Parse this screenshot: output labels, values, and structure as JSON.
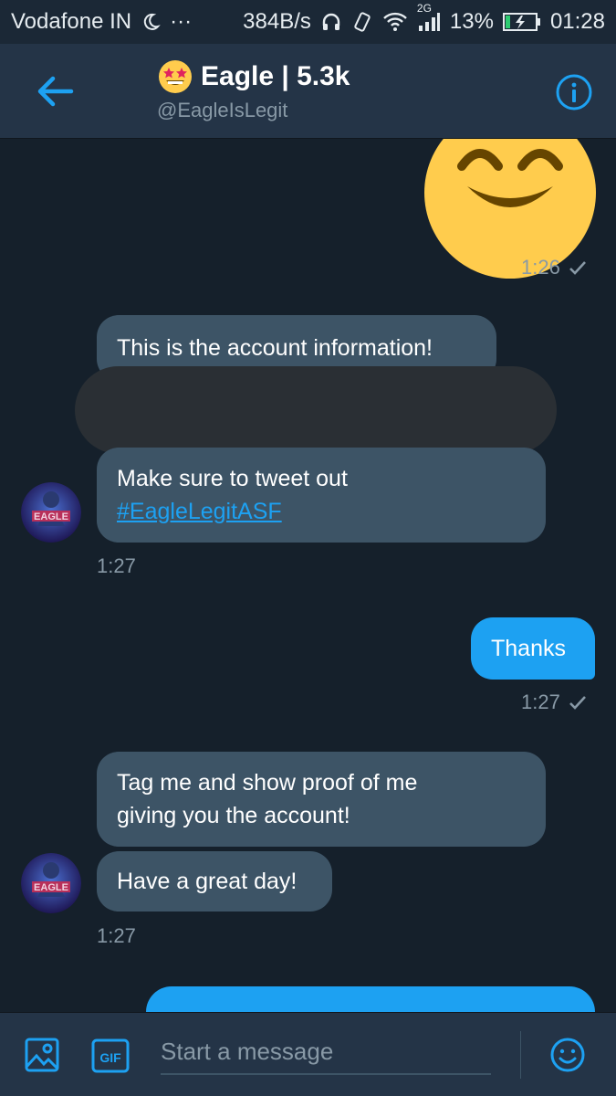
{
  "status_bar": {
    "carrier": "Vodafone IN",
    "dots": "···",
    "speed": "384B/s",
    "network": "2G",
    "battery": "13%",
    "time": "01:28"
  },
  "header": {
    "title": "Eagle | 5.3k",
    "handle": "@EagleIsLegit",
    "back_icon": "arrow-left-icon",
    "info_icon": "info-icon",
    "title_emoji": "star-struck-emoji"
  },
  "messages": [
    {
      "from": "me",
      "type": "emoji",
      "emoji": "smiling-face-emoji",
      "time": "1:26"
    },
    {
      "from": "them",
      "text": "This is the account information!"
    },
    {
      "from": "them",
      "text": "",
      "redacted": true
    },
    {
      "from": "them",
      "text": "Make sure to tweet out",
      "link": "#EagleLegitASF",
      "time": "1:27"
    },
    {
      "from": "me",
      "text": "Thanks",
      "time": "1:27"
    },
    {
      "from": "them",
      "lines": [
        "Tag me and show proof of me",
        "giving you the account!"
      ]
    },
    {
      "from": "them",
      "text": "Have a great day!",
      "time": "1:27"
    }
  ],
  "avatar_label": "EAGLE",
  "composer": {
    "placeholder": "Start a message",
    "gif_label": "GIF",
    "image_icon": "image-icon",
    "emoji_icon": "emoji-icon"
  },
  "colors": {
    "background": "#15202b",
    "header": "#243447",
    "incoming_bubble": "#3d5466",
    "outgoing_bubble": "#1da1f2",
    "accent": "#1da1f2",
    "muted": "#8899a6"
  }
}
